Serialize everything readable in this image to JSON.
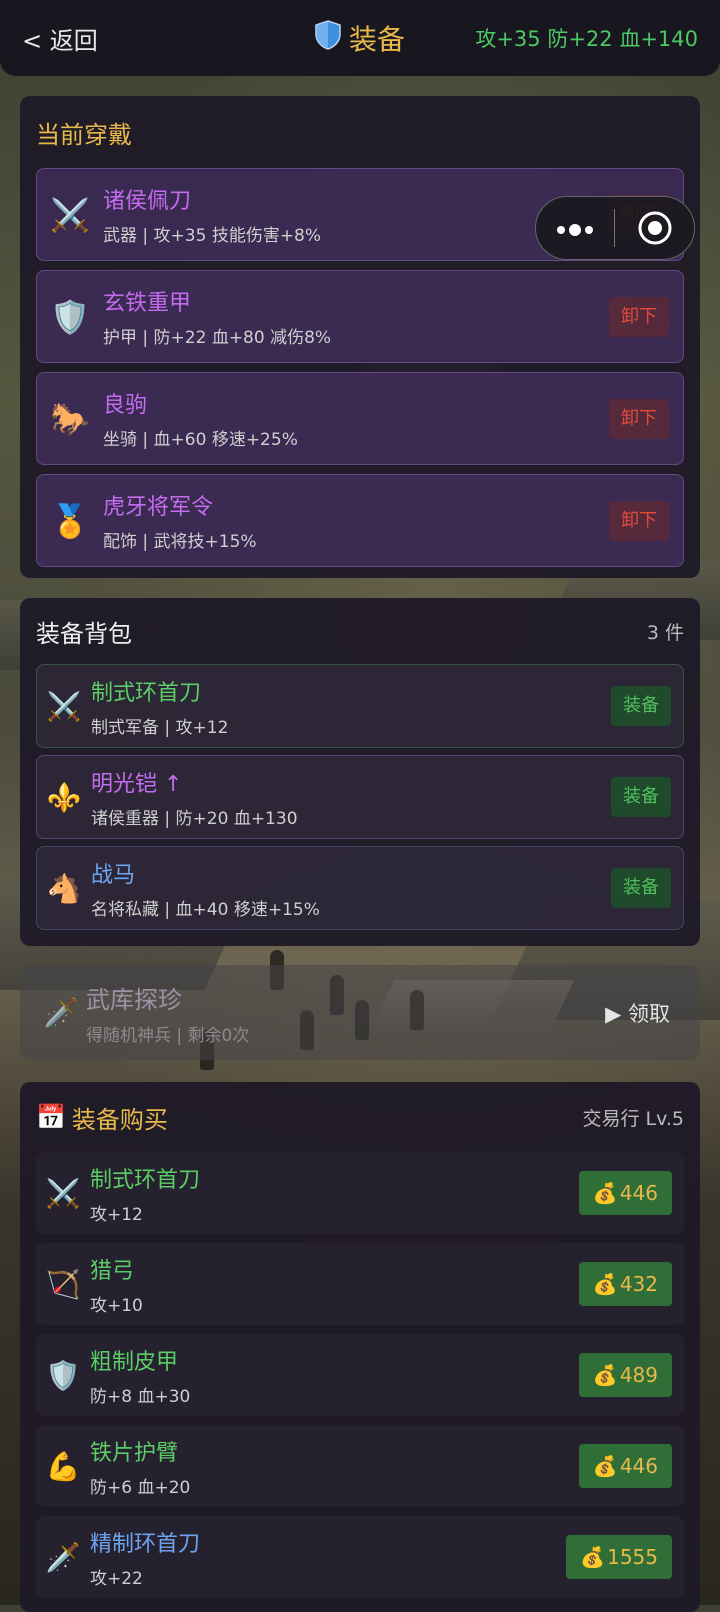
{
  "header": {
    "back_label": "< 返回",
    "title": "装备",
    "stats": "攻+35 防+22 血+140"
  },
  "capsule": {
    "more_glyph": "•●•"
  },
  "equipped": {
    "title": "当前穿戴",
    "items": [
      {
        "icon": "⚔️",
        "icon_name": "crossed-swords-icon",
        "name": "诸侯佩刀",
        "desc": "武器 | 攻+35 技能伤害+8%",
        "action": "卸下"
      },
      {
        "icon": "🛡️",
        "icon_name": "shield-icon",
        "name": "玄铁重甲",
        "desc": "护甲 | 防+22 血+80 减伤8%",
        "action": "卸下"
      },
      {
        "icon": "🐎",
        "icon_name": "horse-icon",
        "name": "良驹",
        "desc": "坐骑 | 血+60 移速+25%",
        "action": "卸下"
      },
      {
        "icon": "🏅",
        "icon_name": "medal-icon",
        "name": "虎牙将军令",
        "desc": "配饰 | 武将技+15%",
        "action": "卸下"
      }
    ]
  },
  "bag": {
    "title": "装备背包",
    "count": "3 件",
    "items": [
      {
        "icon": "⚔️",
        "icon_name": "crossed-swords-icon",
        "name": "制式环首刀",
        "desc": "制式军备 | 攻+12",
        "action": "装备",
        "rarity_color": "#5ccc66"
      },
      {
        "icon": "⚜️",
        "icon_name": "fleur-de-lis-icon",
        "name": "明光铠 ↑",
        "desc": "诸侯重器 | 防+20 血+130",
        "action": "装备",
        "rarity_color": "#c46cf0"
      },
      {
        "icon": "🐴",
        "icon_name": "horse-face-icon",
        "name": "战马",
        "desc": "名将私藏 | 血+40 移速+15%",
        "action": "装备",
        "rarity_color": "#6ea4ee"
      }
    ]
  },
  "armory": {
    "icon": "🗡️",
    "icon_name": "dagger-icon",
    "title": "武库探珍",
    "desc": "得随机神兵 | 剩余0次",
    "action": "▶ 领取"
  },
  "shop": {
    "title": "装备购买",
    "icon": "📅",
    "icon_name": "calendar-icon",
    "level": "交易行 Lv.5",
    "items": [
      {
        "icon": "⚔️",
        "icon_name": "crossed-swords-icon",
        "name": "制式环首刀",
        "desc": "攻+12",
        "price": "446",
        "rarity_color": "#5ccc66"
      },
      {
        "icon": "🏹",
        "icon_name": "bow-and-arrow-icon",
        "name": "猎弓",
        "desc": "攻+10",
        "price": "432",
        "rarity_color": "#5ccc66"
      },
      {
        "icon": "🛡️",
        "icon_name": "shield-icon",
        "name": "粗制皮甲",
        "desc": "防+8 血+30",
        "price": "489",
        "rarity_color": "#5ccc66"
      },
      {
        "icon": "💪",
        "icon_name": "armguard-icon",
        "name": "铁片护臂",
        "desc": "防+6 血+20",
        "price": "446",
        "rarity_color": "#5ccc66"
      },
      {
        "icon": "🗡️",
        "icon_name": "dagger-icon",
        "name": "精制环首刀",
        "desc": "攻+22",
        "price": "1555",
        "rarity_color": "#6ea4ee"
      }
    ],
    "currency_icon": "💰"
  }
}
